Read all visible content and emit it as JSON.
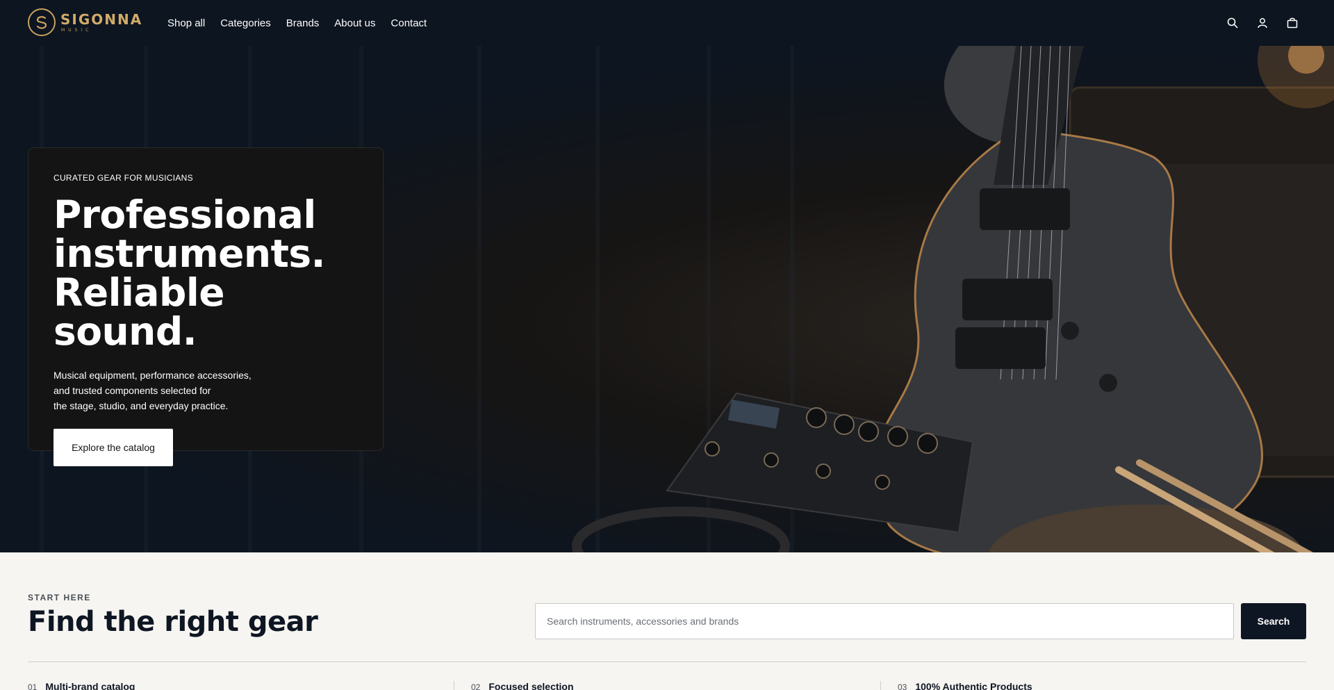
{
  "brand": {
    "name": "SIGONNA",
    "sub": "MUSIC",
    "accent": "#c9a15f"
  },
  "nav": {
    "items": [
      {
        "label": "Shop all"
      },
      {
        "label": "Categories"
      },
      {
        "label": "Brands"
      },
      {
        "label": "About us"
      },
      {
        "label": "Contact"
      }
    ]
  },
  "header_icons": [
    "search-icon",
    "account-icon",
    "bag-icon"
  ],
  "hero": {
    "kicker": "CURATED GEAR FOR MUSICIANS",
    "title_line1": "Professional",
    "title_line2": "instruments.",
    "title_line3": "Reliable sound.",
    "desc_line1": "Musical equipment, performance accessories,",
    "desc_line2": "and trusted components selected for",
    "desc_line3": "the stage, studio, and everyday practice.",
    "cta": "Explore the catalog"
  },
  "start": {
    "kicker": "START HERE",
    "title": "Find the right gear",
    "search_placeholder": "Search instruments, accessories and brands",
    "search_value": "",
    "search_button": "Search"
  },
  "features": [
    {
      "num": "01",
      "label": "Multi-brand catalog"
    },
    {
      "num": "02",
      "label": "Focused selection"
    },
    {
      "num": "03",
      "label": "100% Authentic Products"
    }
  ]
}
